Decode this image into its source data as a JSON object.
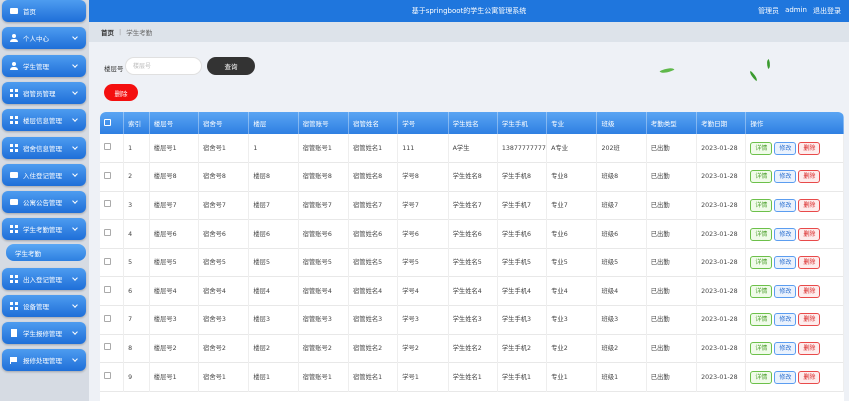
{
  "header": {
    "title": "基于springboot的学生公寓管理系统",
    "role": "管理员",
    "user": "admin",
    "logout": "退出登录"
  },
  "breadcrumb": {
    "home": "首页",
    "separator": "|",
    "current": "学生考勤"
  },
  "sidebar": {
    "items": [
      {
        "label": "首页",
        "icon": "home-icon",
        "has_submenu": false
      },
      {
        "label": "个人中心",
        "icon": "user-icon",
        "has_submenu": true
      },
      {
        "label": "学生管理",
        "icon": "user-icon",
        "has_submenu": true
      },
      {
        "label": "宿管员管理",
        "icon": "grid-icon",
        "has_submenu": true
      },
      {
        "label": "楼层信息管理",
        "icon": "grid-icon",
        "has_submenu": true
      },
      {
        "label": "宿舍信息管理",
        "icon": "grid-icon",
        "has_submenu": true
      },
      {
        "label": "入住登记管理",
        "icon": "box-icon",
        "has_submenu": true
      },
      {
        "label": "公寓公告管理",
        "icon": "box-icon",
        "has_submenu": true
      },
      {
        "label": "学生考勤管理",
        "icon": "grid-icon",
        "has_submenu": true
      },
      {
        "label": "出入登记管理",
        "icon": "grid-icon",
        "has_submenu": true
      },
      {
        "label": "设备管理",
        "icon": "grid-icon",
        "has_submenu": true
      },
      {
        "label": "学生报修管理",
        "icon": "doc-icon",
        "has_submenu": true
      },
      {
        "label": "报修处理管理",
        "icon": "flag-icon",
        "has_submenu": true
      }
    ],
    "active_sub": "学生考勤"
  },
  "search": {
    "label": "楼层号",
    "placeholder": "楼层号",
    "value": "",
    "button": "查询"
  },
  "actions": {
    "delete": "删除"
  },
  "table": {
    "columns": [
      "索引",
      "楼层号",
      "宿舍号",
      "楼层",
      "宿管账号",
      "宿管姓名",
      "学号",
      "学生姓名",
      "学生手机",
      "专业",
      "班级",
      "考勤类型",
      "考勤日期",
      "操作"
    ],
    "row_actions": {
      "detail": "详情",
      "edit": "修改",
      "delete": "删除"
    },
    "rows": [
      [
        "1",
        "楼层号1",
        "宿舍号1",
        "1",
        "宿管账号1",
        "宿管姓名1",
        "111",
        "A学生",
        "13877777777",
        "A专业",
        "202班",
        "已出勤",
        "2023-01-28"
      ],
      [
        "2",
        "楼层号8",
        "宿舍号8",
        "楼层8",
        "宿管账号8",
        "宿管姓名8",
        "学号8",
        "学生姓名8",
        "学生手机8",
        "专业8",
        "班级8",
        "已出勤",
        "2023-01-28"
      ],
      [
        "3",
        "楼层号7",
        "宿舍号7",
        "楼层7",
        "宿管账号7",
        "宿管姓名7",
        "学号7",
        "学生姓名7",
        "学生手机7",
        "专业7",
        "班级7",
        "已出勤",
        "2023-01-28"
      ],
      [
        "4",
        "楼层号6",
        "宿舍号6",
        "楼层6",
        "宿管账号6",
        "宿管姓名6",
        "学号6",
        "学生姓名6",
        "学生手机6",
        "专业6",
        "班级6",
        "已出勤",
        "2023-01-28"
      ],
      [
        "5",
        "楼层号5",
        "宿舍号5",
        "楼层5",
        "宿管账号5",
        "宿管姓名5",
        "学号5",
        "学生姓名5",
        "学生手机5",
        "专业5",
        "班级5",
        "已出勤",
        "2023-01-28"
      ],
      [
        "6",
        "楼层号4",
        "宿舍号4",
        "楼层4",
        "宿管账号4",
        "宿管姓名4",
        "学号4",
        "学生姓名4",
        "学生手机4",
        "专业4",
        "班级4",
        "已出勤",
        "2023-01-28"
      ],
      [
        "7",
        "楼层号3",
        "宿舍号3",
        "楼层3",
        "宿管账号3",
        "宿管姓名3",
        "学号3",
        "学生姓名3",
        "学生手机3",
        "专业3",
        "班级3",
        "已出勤",
        "2023-01-28"
      ],
      [
        "8",
        "楼层号2",
        "宿舍号2",
        "楼层2",
        "宿管账号2",
        "宿管姓名2",
        "学号2",
        "学生姓名2",
        "学生手机2",
        "专业2",
        "班级2",
        "已出勤",
        "2023-01-28"
      ],
      [
        "9",
        "楼层号1",
        "宿舍号1",
        "楼层1",
        "宿管账号1",
        "宿管姓名1",
        "学号1",
        "学生姓名1",
        "学生手机1",
        "专业1",
        "班级1",
        "已出勤",
        "2023-01-28"
      ]
    ]
  },
  "colors": {
    "primary": "#1f76dd",
    "danger": "#f40f0f",
    "dark_button": "#333333",
    "leaf": "#5fb84a"
  }
}
